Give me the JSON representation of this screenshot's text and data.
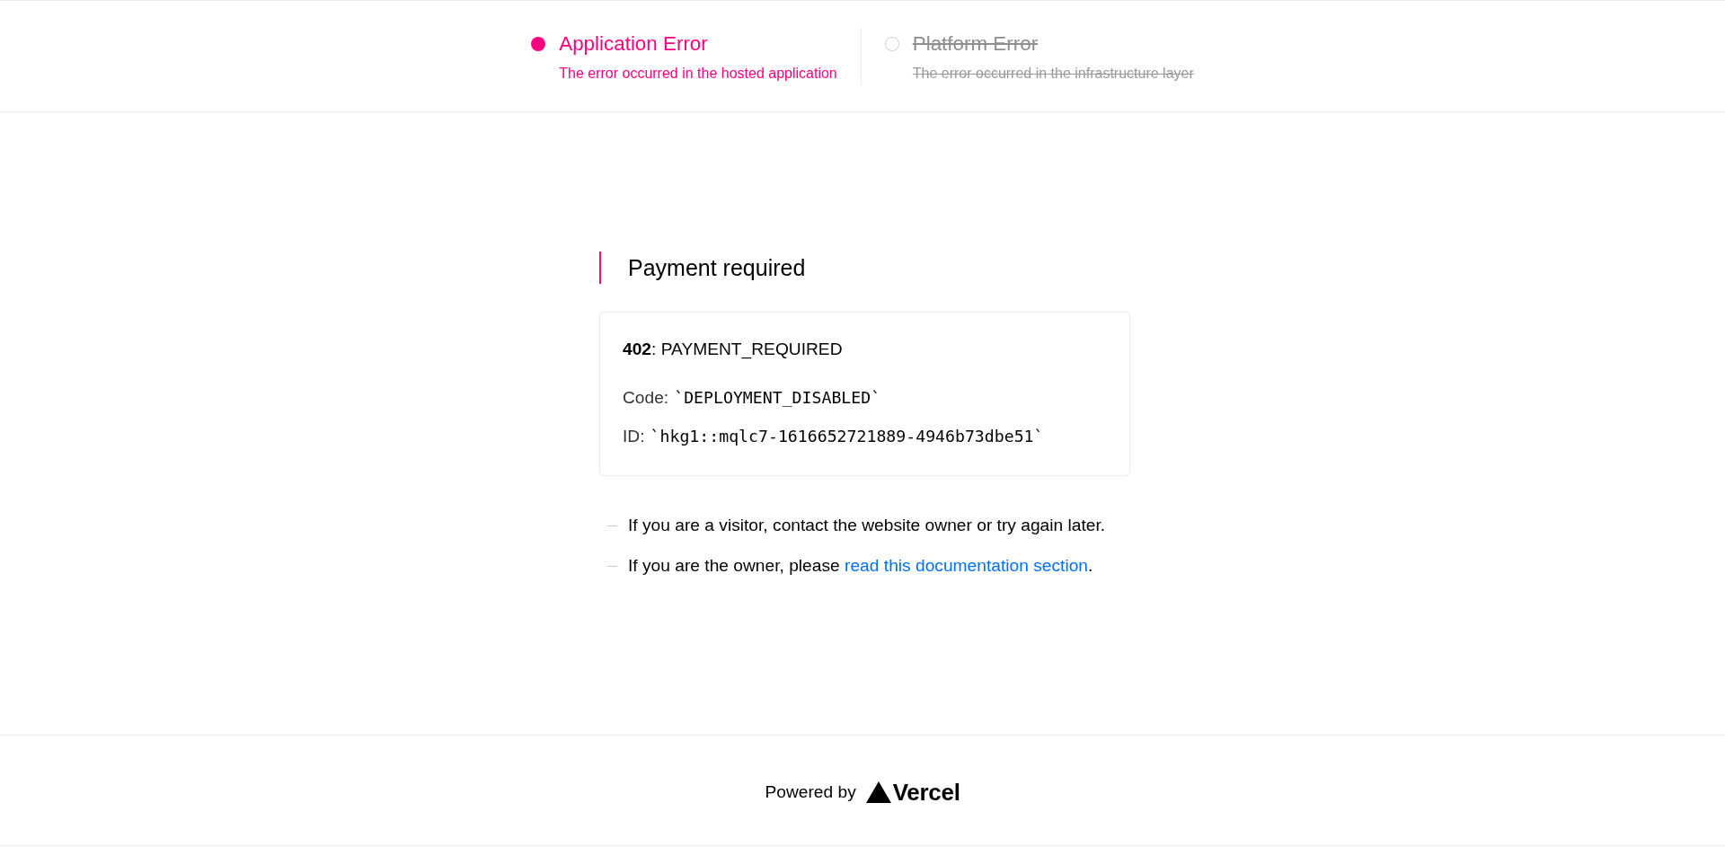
{
  "error_types": [
    {
      "title": "Application Error",
      "description": "The error occurred in the hosted application",
      "active": true
    },
    {
      "title": "Platform Error",
      "description": "The error occurred in the infrastructure layer",
      "active": false
    }
  ],
  "heading": "Payment required",
  "error_card": {
    "status": "**402**: PAYMENT_REQUIRED",
    "code_label": "Code:",
    "code_value": "`DEPLOYMENT_DISABLED`",
    "id_label": "ID:",
    "id_value": "`hkg1::mqlc7-1616652721889-4946b73dbe51`"
  },
  "notes": [
    {
      "text": "If you are a visitor, contact the website owner or try again later."
    },
    {
      "text": "If you are the owner, please ",
      "link": "read this documentation section",
      "text_after": "."
    }
  ],
  "footer": {
    "label": "Powered by",
    "logo_text": "Vercel"
  }
}
